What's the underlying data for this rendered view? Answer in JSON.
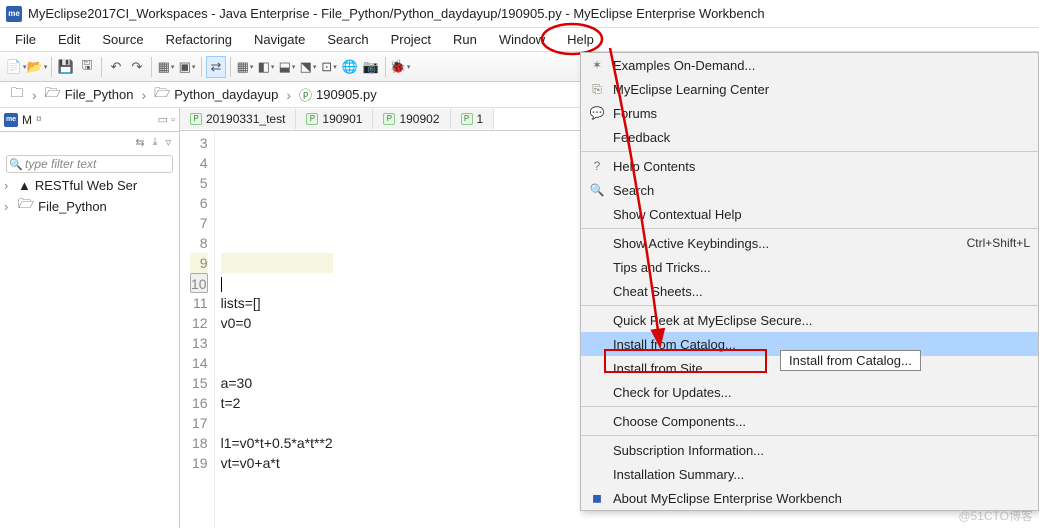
{
  "title": "MyEclipse2017CI_Workspaces - Java Enterprise - File_Python/Python_daydayup/190905.py - MyEclipse Enterprise Workbench",
  "menubar": [
    "File",
    "Edit",
    "Source",
    "Refactoring",
    "Navigate",
    "Search",
    "Project",
    "Run",
    "Window",
    "Help"
  ],
  "breadcrumb": {
    "items": [
      "File_Python",
      "Python_daydayup",
      "190905.py"
    ]
  },
  "left": {
    "tab_label": "M",
    "filter_placeholder": "type filter text",
    "tree": [
      {
        "icon": "server-icon",
        "label": "RESTful Web Ser"
      },
      {
        "icon": "project-icon",
        "label": "File_Python"
      }
    ]
  },
  "editor_tabs": [
    "20190331_test",
    "190901",
    "190902",
    "1"
  ],
  "code_lines": [
    {
      "n": 3,
      "t": ""
    },
    {
      "n": 4,
      "t": ""
    },
    {
      "n": 5,
      "t": ""
    },
    {
      "n": 6,
      "t": ""
    },
    {
      "n": 7,
      "t": ""
    },
    {
      "n": 8,
      "t": ""
    },
    {
      "n": 9,
      "t": "",
      "hl": true
    },
    {
      "n": 10,
      "t": "|",
      "boxed": true
    },
    {
      "n": 11,
      "t": "lists=[]"
    },
    {
      "n": 12,
      "t": "v0=0"
    },
    {
      "n": 13,
      "t": ""
    },
    {
      "n": 14,
      "t": ""
    },
    {
      "n": 15,
      "t": "a=30"
    },
    {
      "n": 16,
      "t": "t=2"
    },
    {
      "n": 17,
      "t": ""
    },
    {
      "n": 18,
      "t": "l1=v0*t+0.5*a*t**2"
    },
    {
      "n": 19,
      "t": "vt=v0+a*t"
    }
  ],
  "dropdown": [
    {
      "icon": "star-icon",
      "label": "Examples On-Demand..."
    },
    {
      "icon": "book-icon",
      "label": "MyEclipse Learning Center"
    },
    {
      "icon": "chat-icon",
      "label": "Forums"
    },
    {
      "icon": "",
      "label": "Feedback"
    },
    {
      "sep": true
    },
    {
      "icon": "help-icon",
      "label": "Help Contents"
    },
    {
      "icon": "search-icon",
      "label": "Search"
    },
    {
      "icon": "",
      "label": "Show Contextual Help"
    },
    {
      "sep": true
    },
    {
      "icon": "",
      "label": "Show Active Keybindings...",
      "accel": "Ctrl+Shift+L"
    },
    {
      "icon": "",
      "label": "Tips and Tricks..."
    },
    {
      "icon": "",
      "label": "Cheat Sheets..."
    },
    {
      "sep": true
    },
    {
      "icon": "",
      "label": "Quick Peek at MyEclipse Secure..."
    },
    {
      "icon": "",
      "label": "Install from Catalog...",
      "hl": true
    },
    {
      "icon": "",
      "label": "Install from Site..."
    },
    {
      "icon": "",
      "label": "Check for Updates..."
    },
    {
      "sep": true
    },
    {
      "icon": "",
      "label": "Choose Components..."
    },
    {
      "sep": true
    },
    {
      "icon": "",
      "label": "Subscription Information..."
    },
    {
      "icon": "",
      "label": "Installation Summary..."
    },
    {
      "icon": "me-icon",
      "label": "About MyEclipse Enterprise Workbench"
    }
  ],
  "tooltip": "Install from Catalog...",
  "watermark": "@51CTO博客"
}
